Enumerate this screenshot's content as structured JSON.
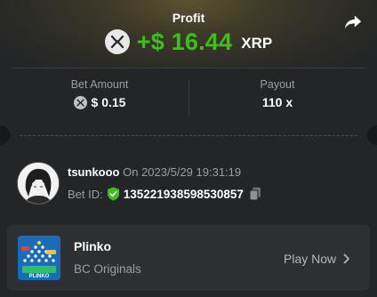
{
  "header": {
    "title": "Profit",
    "amount": "+$ 16.44",
    "currency": "XRP",
    "amount_color": "#3bc117"
  },
  "stats": {
    "bet_amount_label": "Bet Amount",
    "bet_amount_value": "$ 0.15",
    "payout_label": "Payout",
    "payout_value": "110 x"
  },
  "bet": {
    "username": "tsunkooo",
    "on_date": "On 2023/5/29 19:31:19",
    "bet_id_label": "Bet ID:",
    "bet_id": "135221938598530857"
  },
  "game": {
    "title": "Plinko",
    "subtitle": "BC Originals",
    "play_label": "Play Now",
    "thumb_text": "PLINKO"
  },
  "icons": [
    "share-icon",
    "xrp-icon",
    "shield-check-icon",
    "copy-icon",
    "chevron-right-icon"
  ]
}
